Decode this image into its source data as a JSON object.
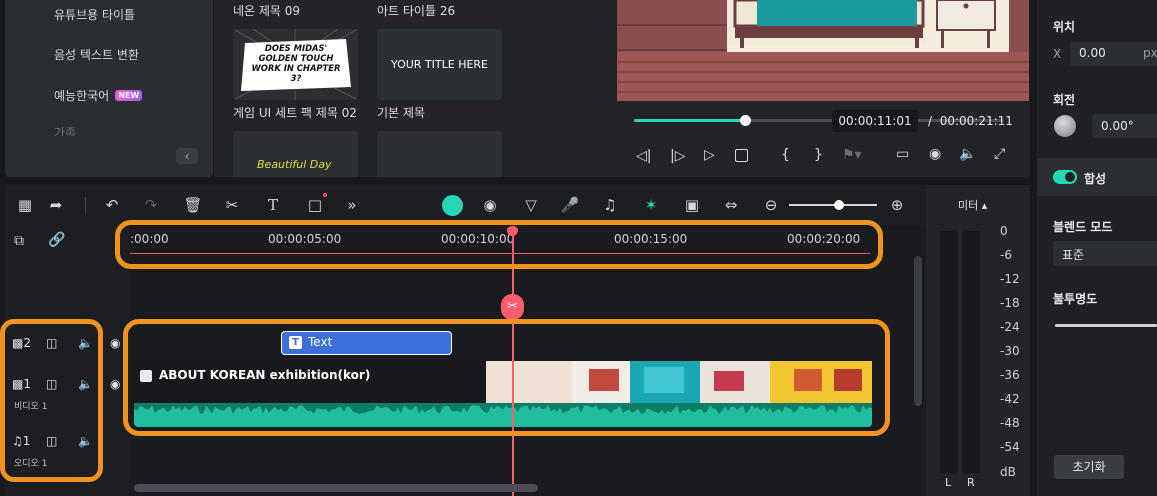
{
  "categories": {
    "items": [
      {
        "label": "유튜브용 타이틀"
      },
      {
        "label": "음성 텍스트 변환"
      },
      {
        "label": "예능한국어",
        "badge": "NEW"
      },
      {
        "label": "가족"
      }
    ]
  },
  "thumbnails": [
    {
      "title": "네온 제목 09",
      "preview_text": "DOES MIDAS' GOLDEN TOUCH WORK IN CHAPTER 3?"
    },
    {
      "title": "아트 타이틀 26",
      "preview_text": "YOUR TITLE HERE"
    },
    {
      "title": "게임 UI 세트 팩 제목 02",
      "preview_text": "Beautiful Day"
    },
    {
      "title": "기본 제목",
      "preview_text": ""
    }
  ],
  "player": {
    "current_time": "00:00:11:01",
    "separator": "/",
    "total_time": "00:00:21:11",
    "progress": 0.3
  },
  "properties": {
    "position_label": "위치",
    "x_label": "X",
    "x_value": "0.00",
    "x_unit": "px",
    "rotation_label": "회전",
    "rotation_value": "0.00°",
    "composite_label": "합성",
    "blend_mode_label": "블렌드 모드",
    "blend_mode_value": "표준",
    "opacity_label": "불투명도",
    "reset_label": "초기화"
  },
  "meter": {
    "title": "미터",
    "scale": [
      "0",
      "-6",
      "-12",
      "-18",
      "-24",
      "-30",
      "-36",
      "-42",
      "-48",
      "-54",
      "dB"
    ],
    "left_label": "L",
    "right_label": "R"
  },
  "ruler": {
    "ticks": [
      ":00:00",
      "00:00:05:00",
      "00:00:10:00",
      "00:00:15:00",
      "00:00:20:00"
    ]
  },
  "tracks": {
    "title_track_num": "2",
    "video_track_num": "1",
    "video_track_name": "비디오 1",
    "audio_track_num": "1",
    "audio_track_name": "오디오 1",
    "text_clip_label": "Text",
    "video_clip_label": "ABOUT KOREAN exhibition(kor)"
  },
  "colors": {
    "accent": "#27d6b8",
    "highlight": "#f2931d",
    "playhead": "#ff5c6c",
    "text_clip": "#3d6fd8",
    "audio_wave": "#1fbf9e"
  }
}
